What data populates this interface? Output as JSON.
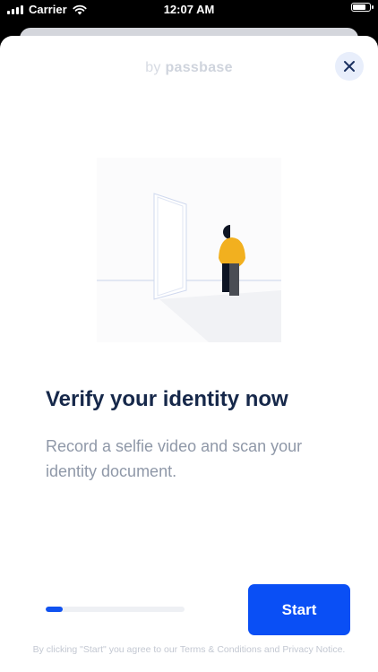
{
  "status_bar": {
    "carrier": "Carrier",
    "time": "12:07 AM",
    "battery_level": 0.9
  },
  "header": {
    "brand_prefix": "by",
    "brand_name": "passbase"
  },
  "main": {
    "title": "Verify your identity now",
    "subtitle": "Record a selfie video and scan your identity document."
  },
  "progress": {
    "value": 0.12
  },
  "footer": {
    "start_label": "Start",
    "disclaimer_prefix": "By clicking \"Start\" you agree to our",
    "terms_label": "Terms & Conditions",
    "conjunction": "and",
    "privacy_label": "Privacy Notice."
  },
  "icons": {
    "close": "close-icon",
    "wifi": "wifi-icon",
    "signal": "signal-icon",
    "battery": "battery-icon"
  },
  "colors": {
    "accent": "#0a4ff5",
    "title": "#16284a",
    "subtitle": "#8f98a8"
  }
}
